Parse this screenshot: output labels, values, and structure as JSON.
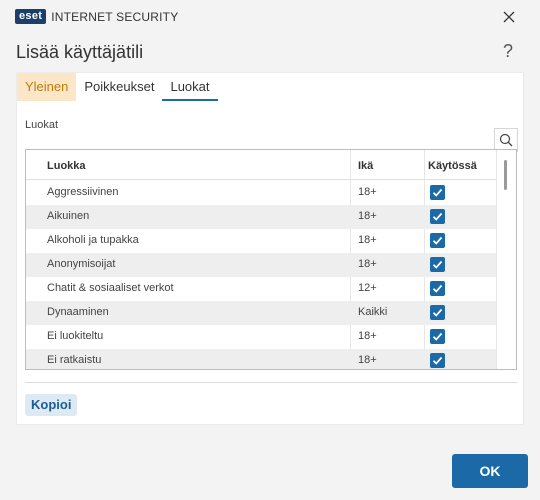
{
  "app": {
    "logo_badge": "eset",
    "product_name": "INTERNET SECURITY"
  },
  "dialog": {
    "title": "Lisää käyttäjätili",
    "help_glyph": "?"
  },
  "tabs": [
    {
      "label": "Yleinen"
    },
    {
      "label": "Poikkeukset"
    },
    {
      "label": "Luokat"
    }
  ],
  "section_label": "Luokat",
  "table": {
    "headers": {
      "category": "Luokka",
      "age": "Ikä",
      "enabled": "Käytössä"
    },
    "rows": [
      {
        "category": "Aggressiivinen",
        "age": "18+",
        "enabled": true
      },
      {
        "category": "Aikuinen",
        "age": "18+",
        "enabled": true
      },
      {
        "category": "Alkoholi ja tupakka",
        "age": "18+",
        "enabled": true
      },
      {
        "category": "Anonymisoijat",
        "age": "18+",
        "enabled": true
      },
      {
        "category": "Chatit & sosiaaliset verkot",
        "age": "12+",
        "enabled": true
      },
      {
        "category": "Dynaaminen",
        "age": "Kaikki",
        "enabled": true
      },
      {
        "category": "Ei luokiteltu",
        "age": "18+",
        "enabled": true
      },
      {
        "category": "Ei ratkaistu",
        "age": "18+",
        "enabled": true
      }
    ]
  },
  "buttons": {
    "copy": "Kopioi",
    "ok": "OK"
  },
  "colors": {
    "brand_blue": "#1b6aa7",
    "warning_tab_bg": "#fbe7c8",
    "warning_tab_text": "#c27a07"
  },
  "icons": {
    "close": "close-icon",
    "search": "search-icon",
    "checkbox": "checkmark-icon"
  }
}
